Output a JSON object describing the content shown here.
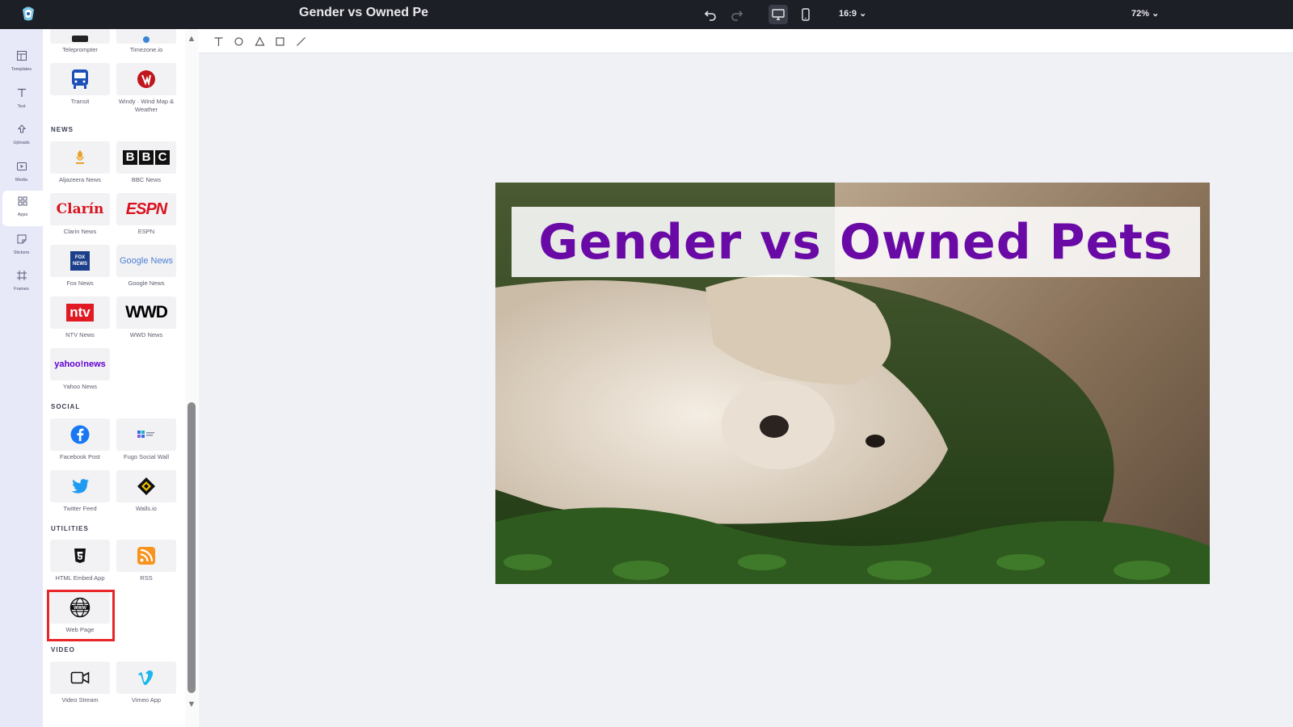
{
  "app": {
    "document_title": "Gender vs Owned Pe",
    "aspect_ratio": "16:9",
    "zoom": "72%"
  },
  "rail": [
    {
      "label": "Templates",
      "icon": "templates-icon"
    },
    {
      "label": "Text",
      "icon": "text-icon"
    },
    {
      "label": "Uploads",
      "icon": "upload-icon"
    },
    {
      "label": "Media",
      "icon": "media-icon"
    },
    {
      "label": "Apps",
      "icon": "apps-icon",
      "active": true
    },
    {
      "label": "Stickers",
      "icon": "sticker-icon"
    },
    {
      "label": "Frames",
      "icon": "frame-icon"
    }
  ],
  "sections": {
    "news": "NEWS",
    "social": "SOCIAL",
    "utilities": "UTILITIES",
    "video": "VIDEO"
  },
  "apps": {
    "teleprompter": "Teleprompter",
    "timezone": "Timezone.io",
    "transit": "Transit",
    "windy": "Windy · Wind Map & Weather",
    "aljazeera": "Aljazeera News",
    "bbc": "BBC News",
    "clarin": "Clarin News",
    "espn": "ESPN",
    "fox": "Fox News",
    "google": "Google News",
    "ntv": "NTV News",
    "wwd": "WWD News",
    "yahoo": "Yahoo News",
    "facebook": "Facebook Post",
    "fugo": "Fugo Social Wall",
    "twitter": "Twitter Feed",
    "walls": "Walls.io",
    "html_embed": "HTML Embed App",
    "rss": "RSS",
    "web_page": "Web Page",
    "video_stream": "Video Stream",
    "vimeo": "Vimeo App"
  },
  "logos": {
    "bbc": "BBC",
    "clarin": "Clarín",
    "espn": "ESPN",
    "ntv": "ntv",
    "wwd": "WWD",
    "google": "Google News",
    "yahoo": "yahoo!news",
    "fox": "FOX NEWS"
  },
  "canvas": {
    "banner_text": "Gender vs Owned Pets"
  },
  "colors": {
    "banner_text": "#6a0aa6",
    "highlight": "#e8262a",
    "topbar": "#1d1f26"
  }
}
